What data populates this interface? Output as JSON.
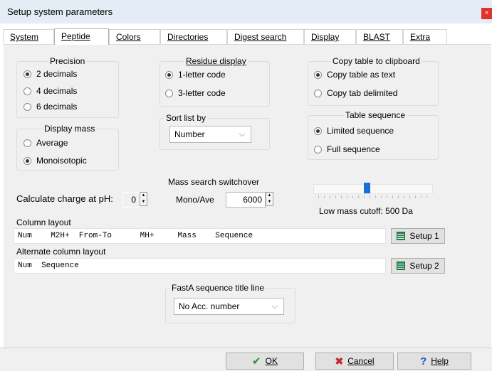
{
  "window": {
    "title": "Setup system parameters",
    "close_label": "×"
  },
  "tabs": [
    {
      "label": "System"
    },
    {
      "label": "Peptide"
    },
    {
      "label": "Colors"
    },
    {
      "label": "Directories"
    },
    {
      "label": "Digest search"
    },
    {
      "label": "Display"
    },
    {
      "label": "BLAST"
    },
    {
      "label": "Extra"
    }
  ],
  "active_tab": "Peptide",
  "precision": {
    "title": "Precision",
    "options": [
      "2 decimals",
      "4 decimals",
      "6 decimals"
    ],
    "selected": "2 decimals"
  },
  "display_mass": {
    "title": "Display mass",
    "options": [
      "Average",
      "Monoisotopic"
    ],
    "selected": "Monoisotopic"
  },
  "residue_display": {
    "title": "Residue display",
    "options": [
      "1-letter code",
      "3-letter code"
    ],
    "selected": "1-letter code"
  },
  "sort_list": {
    "title": "Sort list by",
    "value": "Number"
  },
  "copy_table": {
    "title": "Copy table to clipboard",
    "options": [
      "Copy table as text",
      "Copy tab delimited"
    ],
    "selected": "Copy table as text"
  },
  "table_sequence": {
    "title": "Table sequence",
    "options": [
      "Limited sequence",
      "Full sequence"
    ],
    "selected": "Limited sequence"
  },
  "charge": {
    "label": "Calculate charge at pH:",
    "value": "0"
  },
  "mass_switchover": {
    "title": "Mass search switchover",
    "label": "Mono/Ave",
    "value": "6000"
  },
  "low_mass_cutoff": {
    "label": "Low mass cutoff: 500 Da",
    "level": 0.45
  },
  "column_layout": {
    "label": "Column layout",
    "value": "Num    M2H+  From-To      MH+     Mass    Sequence",
    "button": "Setup 1"
  },
  "alt_column_layout": {
    "label": "Alternate column layout",
    "value": "Num  Sequence",
    "button": "Setup 2"
  },
  "fasta_title": {
    "title": "FastA sequence title line",
    "value": "No Acc. number"
  },
  "footer": {
    "ok": "OK",
    "cancel": "Cancel",
    "help": "Help"
  },
  "colors": {
    "accent": "#1a6fd6",
    "ok_check": "#2e8b2e",
    "cancel_x": "#c62828",
    "help_q": "#1a56c4",
    "close": "#e0332a"
  }
}
